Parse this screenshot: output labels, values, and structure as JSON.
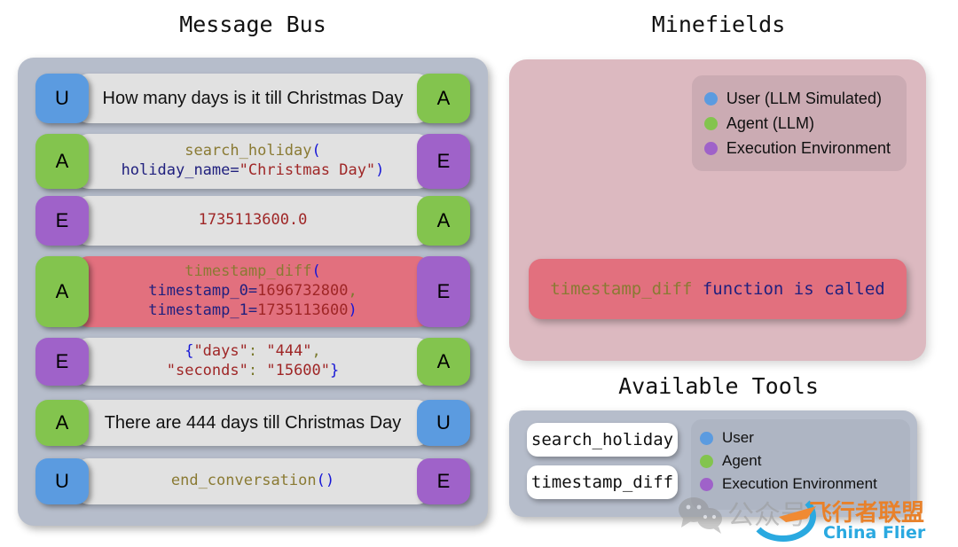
{
  "colors": {
    "user": "#5b9be0",
    "agent": "#83c44e",
    "env": "#9f62c9",
    "alert": "#e2707e",
    "panel_gray": "#b6bdcb",
    "panel_pink": "#dcb9c0",
    "bubble_gray": "#e1e1e1"
  },
  "panels": {
    "message_bus_title": "Message Bus",
    "minefields_title": "Minefields",
    "tools_title": "Available Tools"
  },
  "message_bus": {
    "messages": [
      {
        "from_badge": "U",
        "to_badge": "A",
        "from_role": "user",
        "to_role": "agent",
        "kind": "plain",
        "text": "How many days is it till Christmas Day",
        "alert": false
      },
      {
        "from_badge": "A",
        "to_badge": "E",
        "from_role": "agent",
        "to_role": "env",
        "kind": "code",
        "text": "search_holiday(\nholiday_name=\"Christmas Day\")",
        "alert": false
      },
      {
        "from_badge": "E",
        "to_badge": "A",
        "from_role": "env",
        "to_role": "agent",
        "kind": "code",
        "text": "1735113600.0",
        "alert": false
      },
      {
        "from_badge": "A",
        "to_badge": "E",
        "from_role": "agent",
        "to_role": "env",
        "kind": "code",
        "text": "timestamp_diff(\ntimestamp_0=1696732800,\ntimestamp_1=1735113600)",
        "alert": true
      },
      {
        "from_badge": "E",
        "to_badge": "A",
        "from_role": "env",
        "to_role": "agent",
        "kind": "code",
        "text": "{\"days\": \"444\",\n\"seconds\": \"15600\"}",
        "alert": false
      },
      {
        "from_badge": "A",
        "to_badge": "U",
        "from_role": "agent",
        "to_role": "user",
        "kind": "plain",
        "text": "There are 444 days till Christmas Day",
        "alert": false
      },
      {
        "from_badge": "U",
        "to_badge": "E",
        "from_role": "user",
        "to_role": "env",
        "kind": "code",
        "text": "end_conversation()",
        "alert": false
      }
    ]
  },
  "minefields": {
    "legend": [
      {
        "label": "User (LLM Simulated)",
        "color": "#5b9be0"
      },
      {
        "label": "Agent (LLM)",
        "color": "#83c44e"
      },
      {
        "label": "Execution Environment",
        "color": "#9f62c9"
      }
    ],
    "alert_text": "timestamp_diff function is called",
    "alert_fn": "timestamp_diff",
    "alert_rest": " function is called"
  },
  "tools": {
    "items": [
      {
        "label": "search_holiday"
      },
      {
        "label": "timestamp_diff"
      }
    ],
    "legend": [
      {
        "label": "User",
        "color": "#5b9be0"
      },
      {
        "label": "Agent",
        "color": "#83c44e"
      },
      {
        "label": "Execution Environment",
        "color": "#9f62c9"
      }
    ]
  },
  "watermark": {
    "text_cn": "公众号",
    "text_cn2": "飞行者联盟",
    "text_en": "China Flier"
  }
}
